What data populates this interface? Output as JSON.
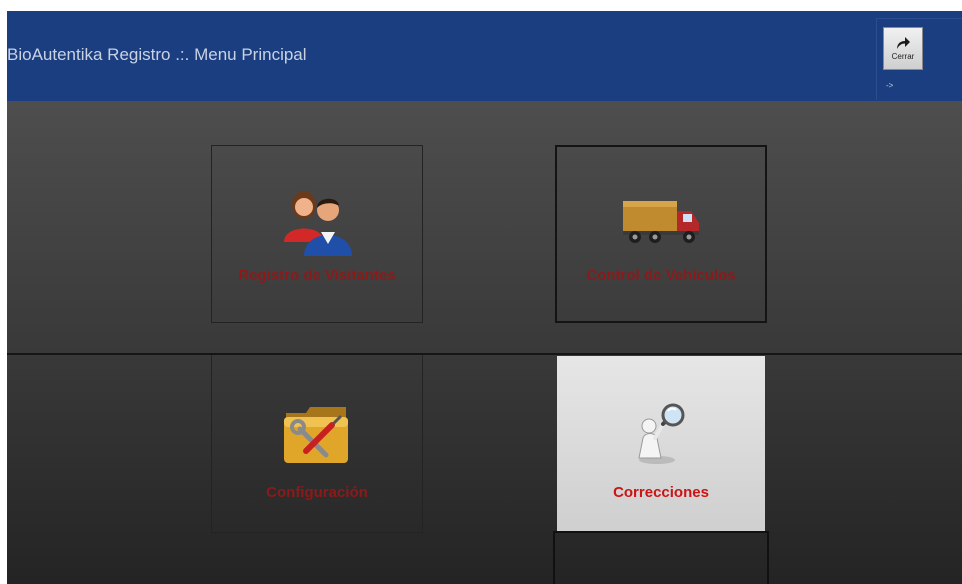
{
  "window": {
    "title": "BioAutentika Registro .:. Menu Principal",
    "colors": {
      "titlebar": "#1b3e80",
      "label": "#8c1a1a",
      "label_active": "#cc1414"
    }
  },
  "close_button": {
    "label": "Cerrar",
    "icon": "share-arrow-icon",
    "hint": "->"
  },
  "tiles": [
    {
      "id": "visitantes",
      "label": "Registro de Visitantes",
      "icon": "people-icon",
      "active": false
    },
    {
      "id": "vehiculos",
      "label": "Control de Vehículos",
      "icon": "truck-icon",
      "active": false
    },
    {
      "id": "configuracion",
      "label": "Configuración",
      "icon": "tools-folder-icon",
      "active": false
    },
    {
      "id": "correcciones",
      "label": "Correcciones",
      "icon": "magnifier-figure-icon",
      "active": true
    }
  ]
}
